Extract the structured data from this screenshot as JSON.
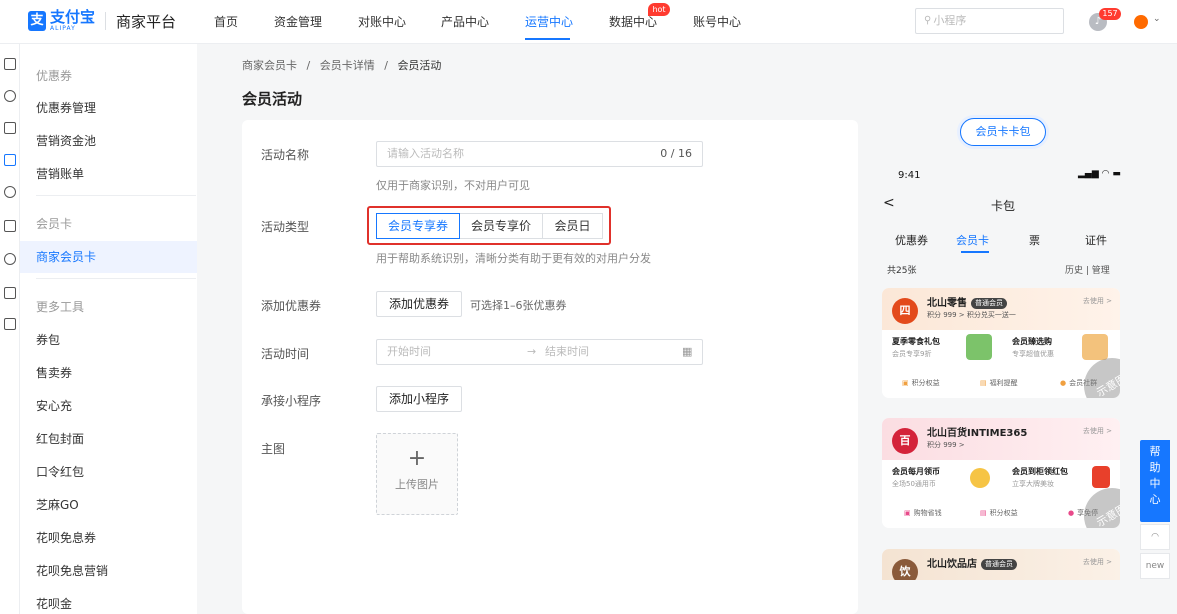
{
  "brand": {
    "mark": "支",
    "cn": "支付宝",
    "en": "ALIPAY",
    "platform": "商家平台"
  },
  "nav": {
    "items": [
      "首页",
      "资金管理",
      "对账中心",
      "产品中心",
      "运营中心",
      "数据中心",
      "账号中心"
    ],
    "active_index": 4,
    "hot_badge": "hot"
  },
  "header": {
    "search_placeholder": "小程序",
    "notifications": "157"
  },
  "sidebar": {
    "coupon_group": "优惠券",
    "coupon_items": [
      "优惠券管理",
      "营销资金池",
      "营销账单"
    ],
    "card_group": "会员卡",
    "card_items": [
      "商家会员卡"
    ],
    "tools_group": "更多工具",
    "tools_items": [
      "券包",
      "售卖券",
      "安心充",
      "红包封面",
      "口令红包",
      "芝麻GO",
      "花呗免息券",
      "花呗免息营销",
      "花呗金"
    ]
  },
  "breadcrumb": [
    "商家会员卡",
    "会员卡详情",
    "会员活动"
  ],
  "breadcrumb_sep": "/",
  "page_title": "会员活动",
  "form": {
    "name_label": "活动名称",
    "name_placeholder": "请输入活动名称",
    "name_count": "0 / 16",
    "name_help": "仅用于商家识别，不对用户可见",
    "type_label": "活动类型",
    "type_options": [
      "会员专享券",
      "会员专享价",
      "会员日"
    ],
    "type_selected": "会员专享券",
    "type_help": "用于帮助系统识别，清晰分类有助于更有效的对用户分发",
    "coupon_label": "添加优惠券",
    "coupon_button": "添加优惠券",
    "coupon_hint": "可选择1–6张优惠券",
    "time_label": "活动时间",
    "time_start": "开始时间",
    "time_arrow": "→",
    "time_end": "结束时间",
    "mini_label": "承接小程序",
    "mini_button": "添加小程序",
    "image_label": "主图",
    "upload_plus": "+",
    "upload_text": "上传图片"
  },
  "preview": {
    "pill": "会员卡卡包",
    "time": "9:41",
    "status": "▂▄▆ ◠ ▬",
    "back": "<",
    "title": "卡包",
    "tabs": [
      "优惠券",
      "会员卡",
      "票",
      "证件"
    ],
    "tab_active": "会员卡",
    "count": "共25张",
    "history": "历史 | 管理",
    "watermark": "示意图",
    "cards": [
      {
        "logo": "四",
        "name": "北山零售",
        "tag": "普通会员",
        "points": "积分 999 >  积分兑买一送一",
        "use": "去使用 >",
        "offer1_title": "夏季零食礼包",
        "offer1_sub": "会员专享9折",
        "offer2_title": "会员臻选购",
        "offer2_sub": "专享超值优惠",
        "foot": [
          "积分权益",
          "福利提醒",
          "会员社群"
        ]
      },
      {
        "logo": "百",
        "name": "北山百货INTIME365",
        "tag": "",
        "points": "积分 999 >",
        "use": "去使用 >",
        "offer1_title": "会员每月领币",
        "offer1_sub": "全场50通用币",
        "offer2_title": "会员到柜领红包",
        "offer2_sub": "立享大牌美妆",
        "foot": [
          "购物省钱",
          "积分权益",
          "享免停"
        ]
      },
      {
        "logo": "饮",
        "name": "北山饮品店",
        "tag": "普通会员",
        "points": "",
        "use": "去使用 >"
      }
    ]
  },
  "help_widget": {
    "text": "帮助中心",
    "new_label": "new"
  },
  "colors": {
    "primary": "#1677ff",
    "highlight_border": "#e0312b",
    "hot": "#ff3b30"
  }
}
